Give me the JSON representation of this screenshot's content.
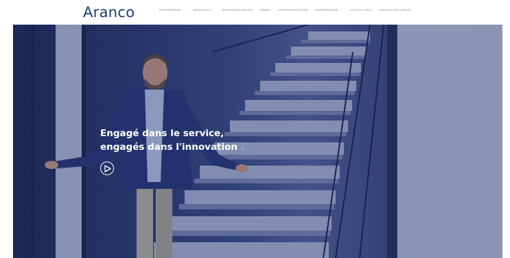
{
  "brand": {
    "logo": "Aranco"
  },
  "nav": {
    "items": [
      {
        "label": "ENTREPRISE",
        "has_dropdown": true
      },
      {
        "label": "SERVICES",
        "has_dropdown": true
      },
      {
        "label": "BRANDINGSDAGS",
        "has_dropdown": false
      },
      {
        "label": "EMBE",
        "has_dropdown": false
      },
      {
        "label": "AUTOMATISATION",
        "has_dropdown": false
      },
      {
        "label": "EXPÉRIENCE",
        "has_dropdown": true
      },
      {
        "label": "ACTUALITÉS",
        "has_dropdown": false
      },
      {
        "label": "CONTACTEZ-NOUS",
        "has_dropdown": true
      }
    ]
  },
  "hero": {
    "headline_line1": "Engagé dans le service,",
    "headline_line2": "engagés dans l'innovation",
    "accent_dot": ".",
    "play_icon": "play-circle-icon"
  },
  "colors": {
    "brand": "#1f3b73",
    "overlay": "#2d3e74",
    "accent_dot": "#7ec8ff"
  }
}
